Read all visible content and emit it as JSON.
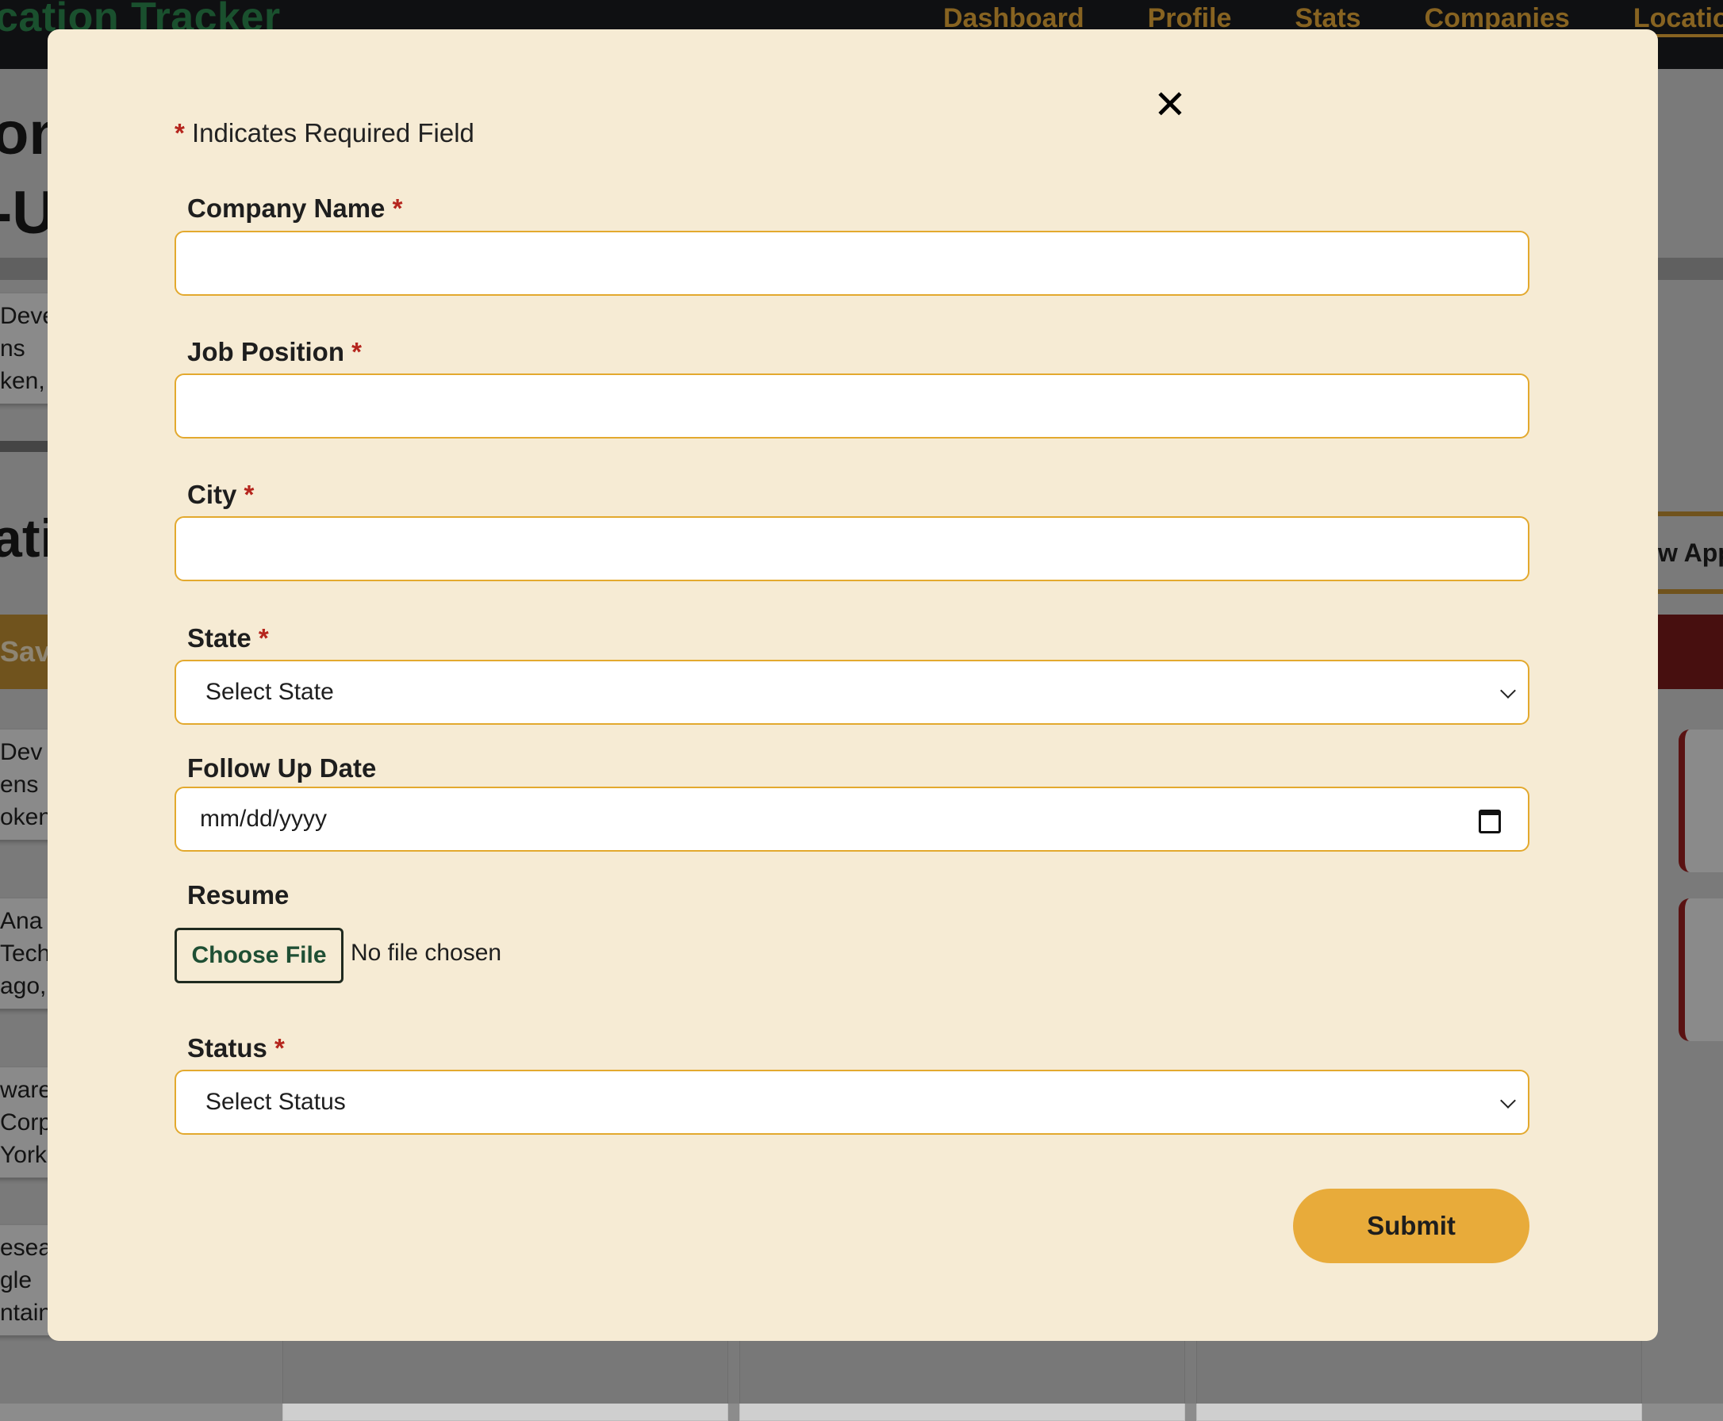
{
  "background": {
    "brand": "cation Tracker",
    "nav": [
      "Dashboard",
      "Profile",
      "Stats",
      "Companies",
      "Locations"
    ],
    "left_title_1": "on",
    "left_title_2": "-U",
    "left_title_3": "ati",
    "card1": [
      "Deve",
      "ns",
      "ken,"
    ],
    "save_label": "Sav",
    "card2": [
      "Dev",
      "ens",
      "oken"
    ],
    "card3": [
      "Ana",
      "Tech",
      "ago,"
    ],
    "card4": [
      "ware",
      "Corp",
      "York"
    ],
    "card5": [
      "esea",
      "gle",
      "ntain View, CA"
    ],
    "new_app_label": "w App"
  },
  "modal": {
    "close_symbol": "✕",
    "required_star": "*",
    "required_note": "Indicates Required Field",
    "fields": {
      "company_name": {
        "label": "Company Name",
        "value": ""
      },
      "job_position": {
        "label": "Job Position",
        "value": ""
      },
      "city": {
        "label": "City",
        "value": ""
      },
      "state": {
        "label": "State",
        "selected": "Select State"
      },
      "follow_up_date": {
        "label": "Follow Up Date",
        "placeholder": "mm/dd/yyyy"
      },
      "resume": {
        "label": "Resume",
        "button": "Choose File",
        "status": "No file chosen"
      },
      "status": {
        "label": "Status",
        "selected": "Select Status"
      }
    },
    "submit_label": "Submit"
  },
  "colors": {
    "modal_bg": "#f6ebd4",
    "accent": "#e8ab3a",
    "required": "#b5251d",
    "brand_green": "#2e8b50"
  }
}
